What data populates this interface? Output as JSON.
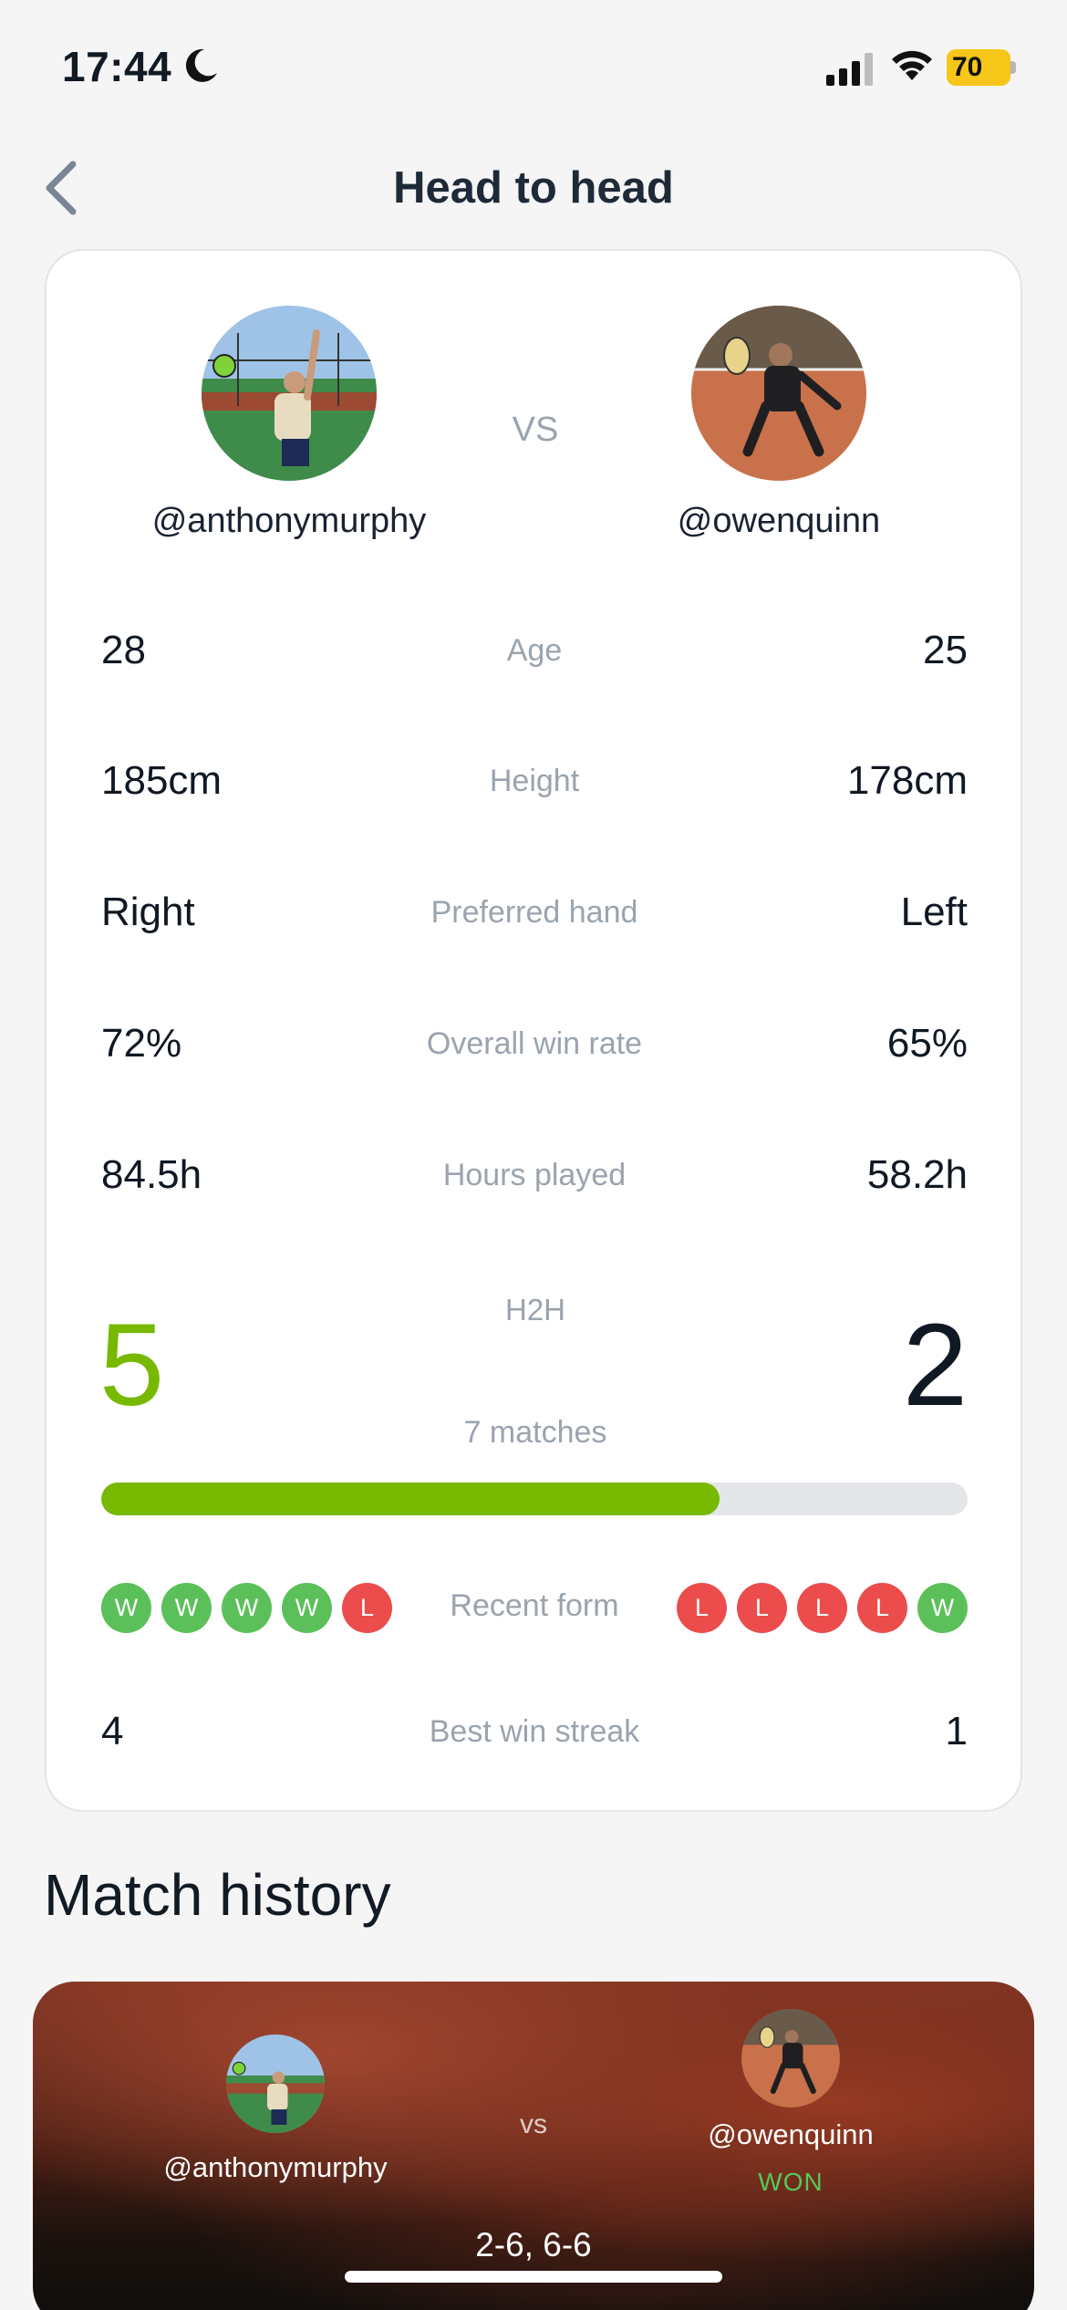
{
  "status_bar": {
    "time": "17:44",
    "battery_level": "70"
  },
  "nav": {
    "title": "Head to head",
    "back_icon": "chevron-left-icon"
  },
  "players": {
    "left": {
      "username": "@anthonymurphy"
    },
    "right": {
      "username": "@owenquinn"
    }
  },
  "vs_label": "VS",
  "stats": [
    {
      "label": "Age",
      "left": "28",
      "right": "25"
    },
    {
      "label": "Height",
      "left": "185cm",
      "right": "178cm"
    },
    {
      "label": "Preferred hand",
      "left": "Right",
      "right": "Left"
    },
    {
      "label": "Overall win rate",
      "left": "72%",
      "right": "65%"
    },
    {
      "label": "Hours played",
      "left": "84.5h",
      "right": "58.2h"
    }
  ],
  "h2h": {
    "label": "H2H",
    "left_wins": "5",
    "right_wins": "2",
    "matches_label": "7 matches",
    "left_share": 0.714
  },
  "recent_form": {
    "label": "Recent form",
    "left": [
      "W",
      "W",
      "W",
      "W",
      "L"
    ],
    "right": [
      "L",
      "L",
      "L",
      "L",
      "W"
    ]
  },
  "best_streak": {
    "label": "Best win streak",
    "left": "4",
    "right": "1"
  },
  "match_history": {
    "title": "Match history",
    "matches": [
      {
        "player_a": "@anthonymurphy",
        "player_b": "@owenquinn",
        "vs": "vs",
        "result_label": "WON",
        "score": "2-6, 6-6"
      }
    ]
  },
  "colors": {
    "accent_green": "#76b900",
    "win_pill": "#5cc05a",
    "loss_pill": "#ec4c4c",
    "muted_text": "#9aa3ae"
  }
}
